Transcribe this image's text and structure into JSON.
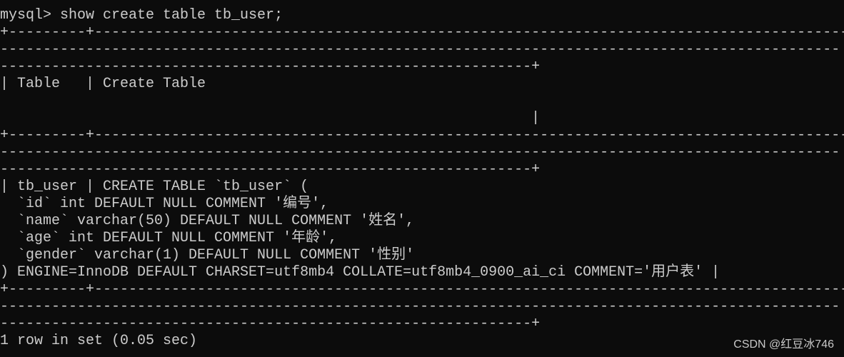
{
  "terminal": {
    "prompt": "mysql> show create table tb_user;",
    "lines": [
      "+---------+-------------------------------------------------------------------------------------------",
      "--------------------------------------------------------------------------------------------------",
      "--------------------------------------------------------------+",
      "| Table   | Create Table",
      "",
      "                                                              |",
      "+---------+-------------------------------------------------------------------------------------------",
      "--------------------------------------------------------------------------------------------------",
      "--------------------------------------------------------------+",
      "| tb_user | CREATE TABLE `tb_user` (",
      "  `id` int DEFAULT NULL COMMENT '编号',",
      "  `name` varchar(50) DEFAULT NULL COMMENT '姓名',",
      "  `age` int DEFAULT NULL COMMENT '年龄',",
      "  `gender` varchar(1) DEFAULT NULL COMMENT '性别'",
      ") ENGINE=InnoDB DEFAULT CHARSET=utf8mb4 COLLATE=utf8mb4_0900_ai_ci COMMENT='用户表' |",
      "+---------+-------------------------------------------------------------------------------------------",
      "--------------------------------------------------------------------------------------------------",
      "--------------------------------------------------------------+",
      "1 row in set (0.05 sec)"
    ]
  },
  "watermark": "CSDN @红豆冰746"
}
